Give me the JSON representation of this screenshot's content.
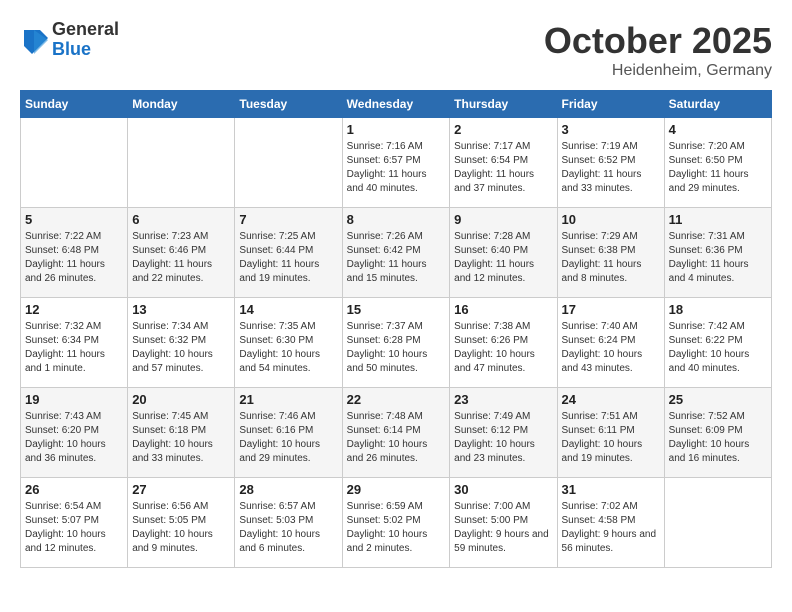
{
  "header": {
    "logo_general": "General",
    "logo_blue": "Blue",
    "month_title": "October 2025",
    "location": "Heidenheim, Germany"
  },
  "weekdays": [
    "Sunday",
    "Monday",
    "Tuesday",
    "Wednesday",
    "Thursday",
    "Friday",
    "Saturday"
  ],
  "weeks": [
    [
      {
        "day": "",
        "sunrise": "",
        "sunset": "",
        "daylight": ""
      },
      {
        "day": "",
        "sunrise": "",
        "sunset": "",
        "daylight": ""
      },
      {
        "day": "",
        "sunrise": "",
        "sunset": "",
        "daylight": ""
      },
      {
        "day": "1",
        "sunrise": "Sunrise: 7:16 AM",
        "sunset": "Sunset: 6:57 PM",
        "daylight": "Daylight: 11 hours and 40 minutes."
      },
      {
        "day": "2",
        "sunrise": "Sunrise: 7:17 AM",
        "sunset": "Sunset: 6:54 PM",
        "daylight": "Daylight: 11 hours and 37 minutes."
      },
      {
        "day": "3",
        "sunrise": "Sunrise: 7:19 AM",
        "sunset": "Sunset: 6:52 PM",
        "daylight": "Daylight: 11 hours and 33 minutes."
      },
      {
        "day": "4",
        "sunrise": "Sunrise: 7:20 AM",
        "sunset": "Sunset: 6:50 PM",
        "daylight": "Daylight: 11 hours and 29 minutes."
      }
    ],
    [
      {
        "day": "5",
        "sunrise": "Sunrise: 7:22 AM",
        "sunset": "Sunset: 6:48 PM",
        "daylight": "Daylight: 11 hours and 26 minutes."
      },
      {
        "day": "6",
        "sunrise": "Sunrise: 7:23 AM",
        "sunset": "Sunset: 6:46 PM",
        "daylight": "Daylight: 11 hours and 22 minutes."
      },
      {
        "day": "7",
        "sunrise": "Sunrise: 7:25 AM",
        "sunset": "Sunset: 6:44 PM",
        "daylight": "Daylight: 11 hours and 19 minutes."
      },
      {
        "day": "8",
        "sunrise": "Sunrise: 7:26 AM",
        "sunset": "Sunset: 6:42 PM",
        "daylight": "Daylight: 11 hours and 15 minutes."
      },
      {
        "day": "9",
        "sunrise": "Sunrise: 7:28 AM",
        "sunset": "Sunset: 6:40 PM",
        "daylight": "Daylight: 11 hours and 12 minutes."
      },
      {
        "day": "10",
        "sunrise": "Sunrise: 7:29 AM",
        "sunset": "Sunset: 6:38 PM",
        "daylight": "Daylight: 11 hours and 8 minutes."
      },
      {
        "day": "11",
        "sunrise": "Sunrise: 7:31 AM",
        "sunset": "Sunset: 6:36 PM",
        "daylight": "Daylight: 11 hours and 4 minutes."
      }
    ],
    [
      {
        "day": "12",
        "sunrise": "Sunrise: 7:32 AM",
        "sunset": "Sunset: 6:34 PM",
        "daylight": "Daylight: 11 hours and 1 minute."
      },
      {
        "day": "13",
        "sunrise": "Sunrise: 7:34 AM",
        "sunset": "Sunset: 6:32 PM",
        "daylight": "Daylight: 10 hours and 57 minutes."
      },
      {
        "day": "14",
        "sunrise": "Sunrise: 7:35 AM",
        "sunset": "Sunset: 6:30 PM",
        "daylight": "Daylight: 10 hours and 54 minutes."
      },
      {
        "day": "15",
        "sunrise": "Sunrise: 7:37 AM",
        "sunset": "Sunset: 6:28 PM",
        "daylight": "Daylight: 10 hours and 50 minutes."
      },
      {
        "day": "16",
        "sunrise": "Sunrise: 7:38 AM",
        "sunset": "Sunset: 6:26 PM",
        "daylight": "Daylight: 10 hours and 47 minutes."
      },
      {
        "day": "17",
        "sunrise": "Sunrise: 7:40 AM",
        "sunset": "Sunset: 6:24 PM",
        "daylight": "Daylight: 10 hours and 43 minutes."
      },
      {
        "day": "18",
        "sunrise": "Sunrise: 7:42 AM",
        "sunset": "Sunset: 6:22 PM",
        "daylight": "Daylight: 10 hours and 40 minutes."
      }
    ],
    [
      {
        "day": "19",
        "sunrise": "Sunrise: 7:43 AM",
        "sunset": "Sunset: 6:20 PM",
        "daylight": "Daylight: 10 hours and 36 minutes."
      },
      {
        "day": "20",
        "sunrise": "Sunrise: 7:45 AM",
        "sunset": "Sunset: 6:18 PM",
        "daylight": "Daylight: 10 hours and 33 minutes."
      },
      {
        "day": "21",
        "sunrise": "Sunrise: 7:46 AM",
        "sunset": "Sunset: 6:16 PM",
        "daylight": "Daylight: 10 hours and 29 minutes."
      },
      {
        "day": "22",
        "sunrise": "Sunrise: 7:48 AM",
        "sunset": "Sunset: 6:14 PM",
        "daylight": "Daylight: 10 hours and 26 minutes."
      },
      {
        "day": "23",
        "sunrise": "Sunrise: 7:49 AM",
        "sunset": "Sunset: 6:12 PM",
        "daylight": "Daylight: 10 hours and 23 minutes."
      },
      {
        "day": "24",
        "sunrise": "Sunrise: 7:51 AM",
        "sunset": "Sunset: 6:11 PM",
        "daylight": "Daylight: 10 hours and 19 minutes."
      },
      {
        "day": "25",
        "sunrise": "Sunrise: 7:52 AM",
        "sunset": "Sunset: 6:09 PM",
        "daylight": "Daylight: 10 hours and 16 minutes."
      }
    ],
    [
      {
        "day": "26",
        "sunrise": "Sunrise: 6:54 AM",
        "sunset": "Sunset: 5:07 PM",
        "daylight": "Daylight: 10 hours and 12 minutes."
      },
      {
        "day": "27",
        "sunrise": "Sunrise: 6:56 AM",
        "sunset": "Sunset: 5:05 PM",
        "daylight": "Daylight: 10 hours and 9 minutes."
      },
      {
        "day": "28",
        "sunrise": "Sunrise: 6:57 AM",
        "sunset": "Sunset: 5:03 PM",
        "daylight": "Daylight: 10 hours and 6 minutes."
      },
      {
        "day": "29",
        "sunrise": "Sunrise: 6:59 AM",
        "sunset": "Sunset: 5:02 PM",
        "daylight": "Daylight: 10 hours and 2 minutes."
      },
      {
        "day": "30",
        "sunrise": "Sunrise: 7:00 AM",
        "sunset": "Sunset: 5:00 PM",
        "daylight": "Daylight: 9 hours and 59 minutes."
      },
      {
        "day": "31",
        "sunrise": "Sunrise: 7:02 AM",
        "sunset": "Sunset: 4:58 PM",
        "daylight": "Daylight: 9 hours and 56 minutes."
      },
      {
        "day": "",
        "sunrise": "",
        "sunset": "",
        "daylight": ""
      }
    ]
  ]
}
